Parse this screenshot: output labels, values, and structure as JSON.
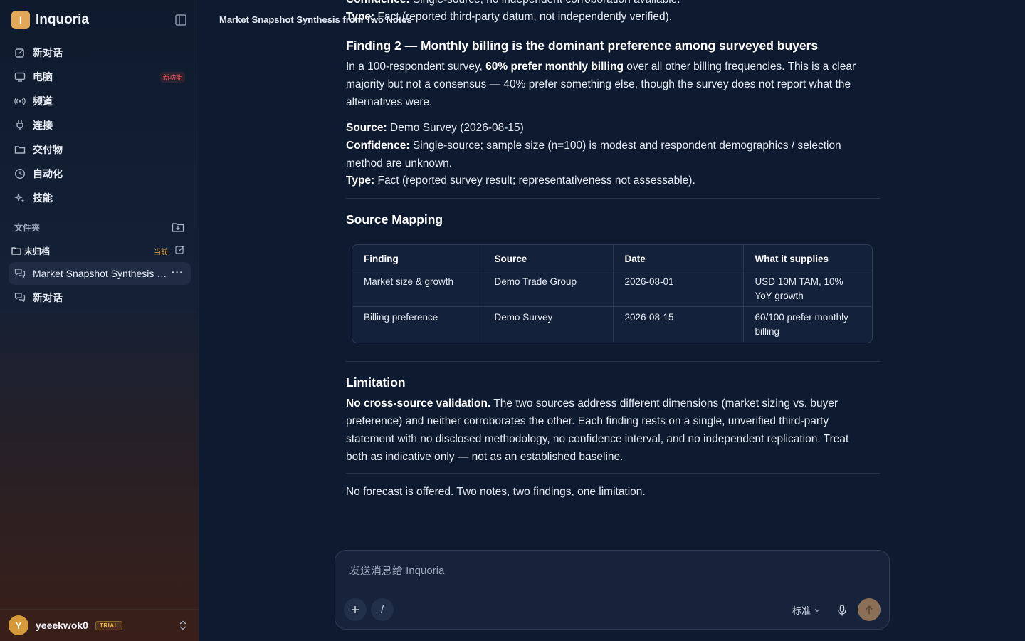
{
  "app": {
    "logo_letter": "I",
    "name": "Inquoria",
    "brand_color": "#e3a857"
  },
  "sidebar": {
    "nav": [
      {
        "label": "新对话",
        "icon": "new-chat-icon"
      },
      {
        "label": "电脑",
        "icon": "monitor-icon",
        "badge": "新功能"
      },
      {
        "label": "频道",
        "icon": "broadcast-icon"
      },
      {
        "label": "连接",
        "icon": "plug-icon"
      },
      {
        "label": "交付物",
        "icon": "folder-icon"
      },
      {
        "label": "自动化",
        "icon": "clock-icon"
      },
      {
        "label": "技能",
        "icon": "sparkle-icon"
      }
    ],
    "folders_title": "文件夹",
    "folder": {
      "name": "未归档",
      "current_label": "当前"
    },
    "conversations": [
      {
        "title": "Market Snapshot Synthesis from Two Notes",
        "active": true
      },
      {
        "title": "新对话",
        "active": false
      }
    ],
    "user": {
      "avatar_letter": "Y",
      "name": "yeeekwok0",
      "plan": "TRIAL"
    }
  },
  "header": {
    "title": "Market Snapshot Synthesis from Two Notes"
  },
  "content": {
    "partial_confidence": {
      "label": "Confidence:",
      "text": " Single-source; no independent corroboration available."
    },
    "partial_type": {
      "label": "Type:",
      "text": " Fact (reported third-party datum, not independently verified)."
    },
    "finding2": {
      "heading": "Finding 2 — Monthly billing is the dominant preference among surveyed buyers",
      "para_pre": "In a 100-respondent survey, ",
      "para_bold": "60% prefer monthly billing",
      "para_post": " over all other billing frequencies. This is a clear majority but not a consensus — 40% prefer something else, though the survey does not report what the alternatives were.",
      "source_label": "Source:",
      "source_text": " Demo Survey (2026-08-15)",
      "confidence_label": "Confidence:",
      "confidence_text": " Single-source; sample size (n=100) is modest and respondent demographics / selection method are unknown.",
      "type_label": "Type:",
      "type_text": " Fact (reported survey result; representativeness not assessable)."
    },
    "mapping": {
      "heading": "Source Mapping",
      "columns": [
        "Finding",
        "Source",
        "Date",
        "What it supplies"
      ],
      "rows": [
        [
          "Market size & growth",
          "Demo Trade Group",
          "2026-08-01",
          "USD 10M TAM, 10% YoY growth"
        ],
        [
          "Billing preference",
          "Demo Survey",
          "2026-08-15",
          "60/100 prefer monthly billing"
        ]
      ]
    },
    "limitation": {
      "heading": "Limitation",
      "bold": "No cross-source validation.",
      "text": " The two sources address different dimensions (market sizing vs. buyer preference) and neither corroborates the other. Each finding rests on a single, unverified third-party statement with no disclosed methodology, no confidence interval, and no independent replication. Treat both as indicative only — not as an established baseline."
    },
    "closing": "No forecast is offered. Two notes, two findings, one limitation."
  },
  "composer": {
    "placeholder": "发送消息给 Inquoria",
    "slash": "/",
    "mode": "标准"
  }
}
